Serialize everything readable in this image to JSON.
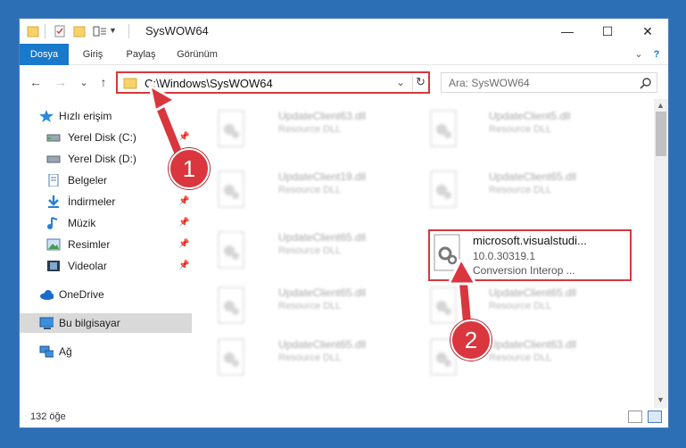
{
  "window": {
    "title": "SysWOW64",
    "minimize": "—",
    "maximize": "☐",
    "close": "✕"
  },
  "ribbon": {
    "tabs": [
      "Dosya",
      "Giriş",
      "Paylaş",
      "Görünüm"
    ],
    "expand": "⌄",
    "help": "?"
  },
  "nav": {
    "back": "←",
    "forward": "→",
    "recent": "⌄",
    "up": "↑",
    "address": "C:\\Windows\\SysWOW64",
    "address_dropdown": "⌄",
    "refresh": "↻",
    "search_placeholder": "Ara: SysWOW64"
  },
  "sidebar": {
    "items": [
      {
        "label": "Hızlı erişim",
        "icon": "star-icon"
      },
      {
        "label": "Yerel Disk (C:)",
        "icon": "drive-icon",
        "pinned": true
      },
      {
        "label": "Yerel Disk (D:)",
        "icon": "drive-icon"
      },
      {
        "label": "Belgeler",
        "icon": "documents-icon",
        "pinned": true
      },
      {
        "label": "İndirmeler",
        "icon": "download-icon",
        "pinned": true
      },
      {
        "label": "Müzik",
        "icon": "music-icon",
        "pinned": true
      },
      {
        "label": "Resimler",
        "icon": "pictures-icon",
        "pinned": true
      },
      {
        "label": "Videolar",
        "icon": "videos-icon",
        "pinned": true
      },
      {
        "label": "OneDrive",
        "icon": "cloud-icon"
      },
      {
        "label": "Bu bilgisayar",
        "icon": "computer-icon",
        "selected": true
      },
      {
        "label": "Ağ",
        "icon": "network-icon"
      }
    ]
  },
  "files": [
    {
      "name": "UpdateClient63.dll",
      "type": "Resource DLL"
    },
    {
      "name": "UpdateClient5.dll",
      "type": "Resource DLL"
    },
    {
      "name": "UpdateClient19.dll",
      "type": "Resource DLL"
    },
    {
      "name": "UpdateClient65.dll",
      "type": "Resource DLL"
    },
    {
      "name": "UpdateClient65.dll",
      "type": "Resource DLL"
    },
    {
      "name": "UpdateClient65.dll",
      "type": "Resource DLL"
    },
    {
      "name": "UpdateClient65.dll",
      "type": "Resource DLL"
    },
    {
      "name": "UpdateClient65.dll",
      "type": "Resource DLL"
    },
    {
      "name": "UpdateClient63.dll",
      "type": "Resource DLL"
    }
  ],
  "focused_file": {
    "name": "microsoft.visualstudi...",
    "version": "10.0.30319.1",
    "description": "Conversion Interop ..."
  },
  "status": {
    "count": "132 öğe"
  },
  "annotations": {
    "step1": "1",
    "step2": "2",
    "color": "#d9363e"
  }
}
